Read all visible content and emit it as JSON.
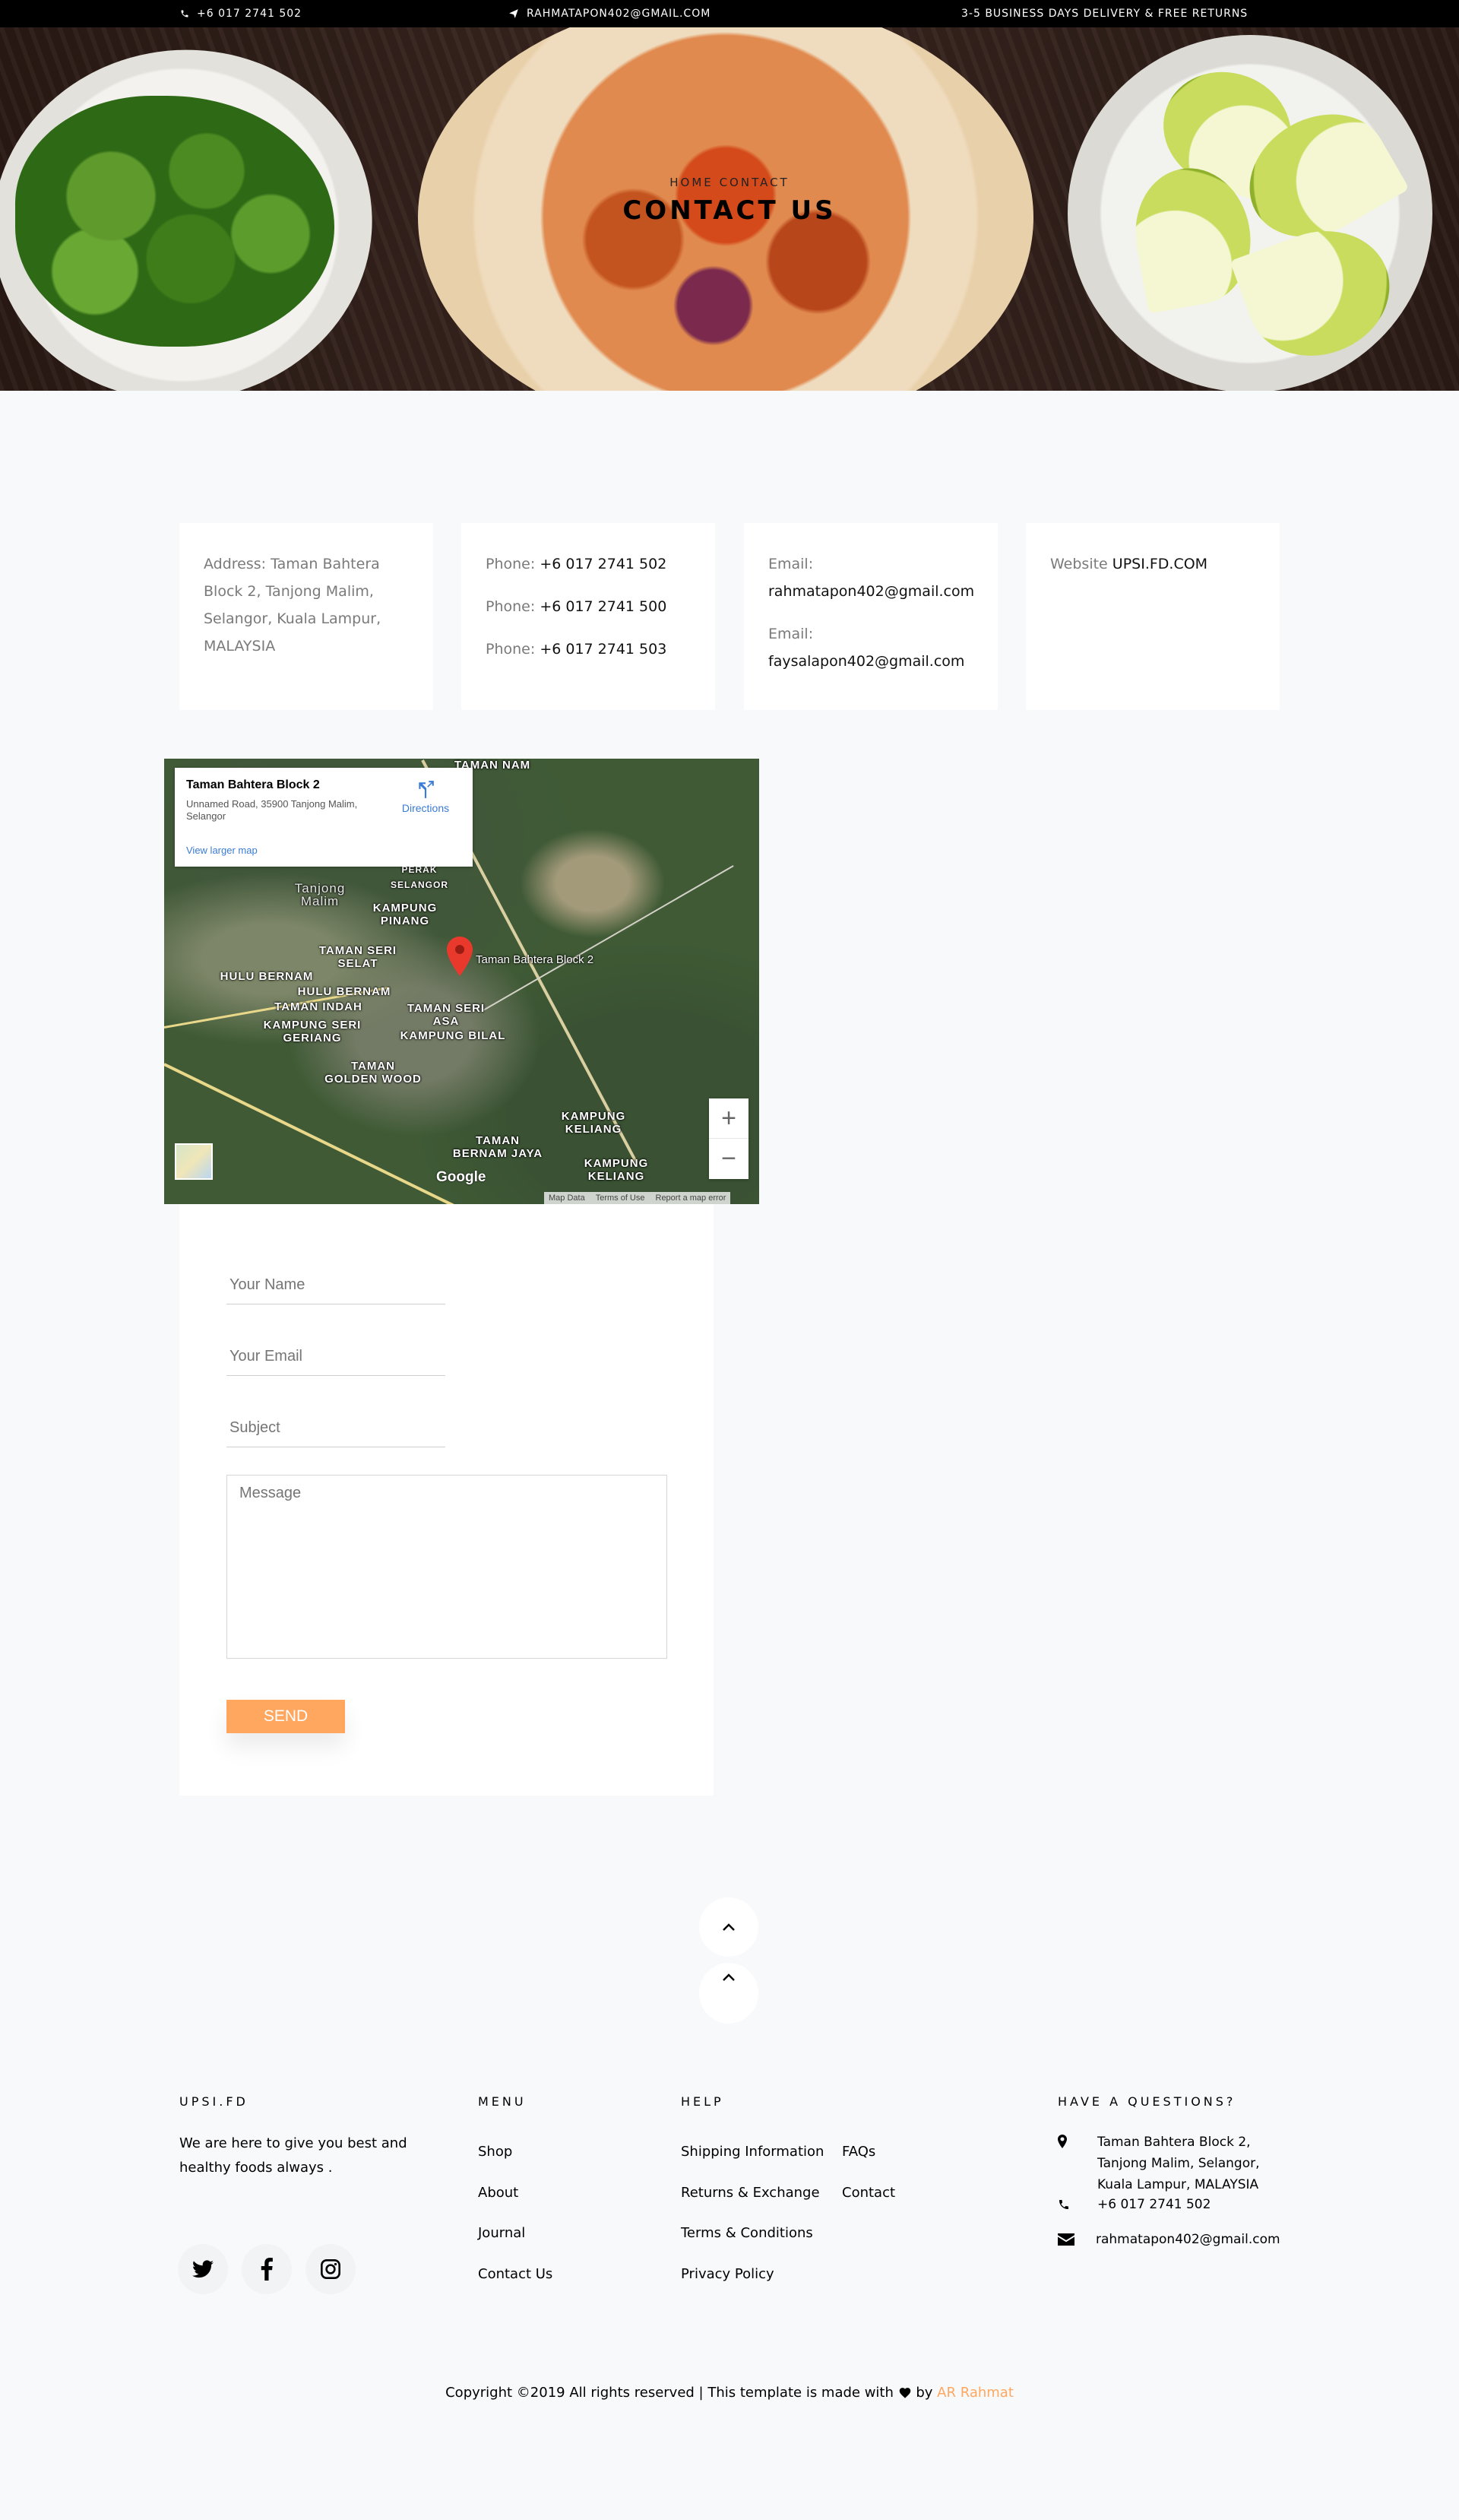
{
  "topbar": {
    "phone": "+6 017 2741 502",
    "email": "RAHMATAPON402@GMAIL.COM",
    "delivery": "3-5 BUSINESS DAYS DELIVERY & FREE RETURNS"
  },
  "hero": {
    "breadcrumb_home": "HOME",
    "breadcrumb_current": "CONTACT",
    "title": "CONTACT US"
  },
  "info_cards": {
    "address_label": "Address:",
    "address_value": "Taman Bahtera Block 2, Tanjong Malim, Selangor, Kuala Lampur, MALAYSIA",
    "phone_label": "Phone:",
    "phones": [
      "+6 017 2741 502",
      "+6 017 2741 500",
      "+6 017 2741 503"
    ],
    "email_label": "Email:",
    "emails": [
      "rahmatapon402@gmail.com",
      "faysalapon402@gmail.com"
    ],
    "website_label": "Website",
    "website_value": "UPSI.FD.COM"
  },
  "map": {
    "place_title": "Taman Bahtera Block 2",
    "place_address": "Unnamed Road, 35900 Tanjong Malim, Selangor",
    "view_larger": "View larger map",
    "directions": "Directions",
    "pin_label": "Taman Bahtera Block 2",
    "areas": [
      "TAMAN NAM",
      "PERAK",
      "SELANGOR",
      "Tanjong Malim",
      "KAMPUNG PINANG",
      "TAMAN SERI SELAT",
      "HULU BERNAM",
      "HULU BERNAM",
      "TAMAN INDAH",
      "KAMPUNG SERI GERIANG",
      "TAMAN SERI ASA",
      "KAMPUNG BILAL",
      "TAMAN GOLDEN WOOD",
      "KAMPUNG KELIANG",
      "TAMAN BERNAM JAYA",
      "KAMPUNG KELIANG"
    ],
    "zoom_in": "+",
    "zoom_out": "−",
    "google": "Google",
    "footer_links": [
      "Map Data",
      "Terms of Use",
      "Report a map error"
    ]
  },
  "form": {
    "name_placeholder": "Your Name",
    "email_placeholder": "Your Email",
    "subject_placeholder": "Subject",
    "message_placeholder": "Message",
    "send_label": "SEND"
  },
  "footer": {
    "brand_heading": "UPSI.FD",
    "brand_text": "We are here to give you best and healthy foods always .",
    "menu_heading": "MENU",
    "menu_items": [
      "Shop",
      "About",
      "Journal",
      "Contact Us"
    ],
    "help_heading": "HELP",
    "help_col1": [
      "Shipping Information",
      "Returns & Exchange",
      "Terms & Conditions",
      "Privacy Policy"
    ],
    "help_col2": [
      "FAQs",
      "Contact"
    ],
    "contact_heading": "HAVE A QUESTIONS?",
    "contact_address": "Taman Bahtera Block 2, Tanjong Malim, Selangor, Kuala Lampur, MALAYSIA",
    "contact_phone": "+6 017 2741 502",
    "contact_email": "rahmatapon402@gmail.com",
    "copyright_prefix": "Copyright ©2019 All rights reserved | This template is made with",
    "copyright_by": "by",
    "copyright_author": "AR Rahmat"
  },
  "colors": {
    "accent": "#ffa75f",
    "topbar_bg": "#000000",
    "page_bg": "#f8f9fb"
  }
}
